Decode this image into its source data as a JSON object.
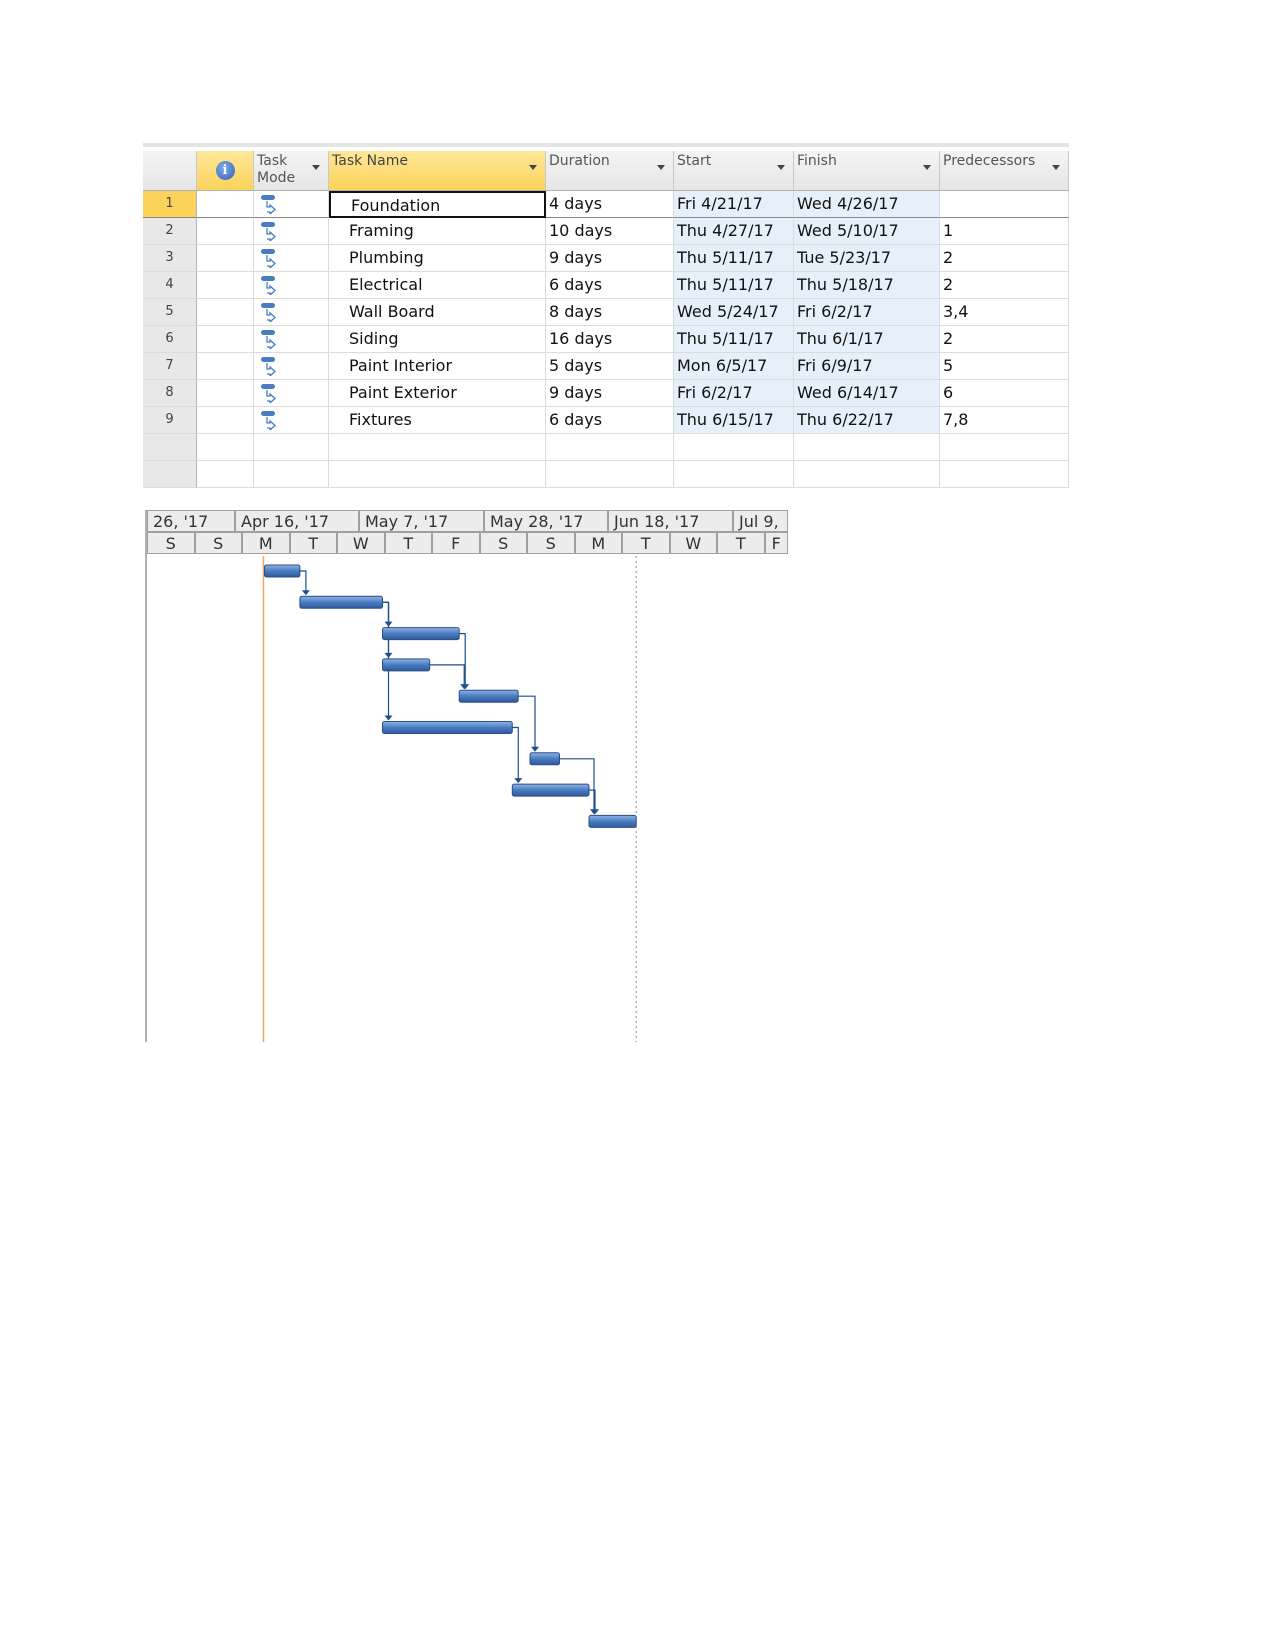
{
  "table": {
    "headers": {
      "info_icon": "info-icon",
      "task_mode": "Task Mode",
      "task_name": "Task Name",
      "duration": "Duration",
      "start": "Start",
      "finish": "Finish",
      "predecessors": "Predecessors"
    },
    "rows": [
      {
        "id": "1",
        "name": "Foundation",
        "duration": "4 days",
        "start": "Fri 4/21/17",
        "finish": "Wed 4/26/17",
        "pred": ""
      },
      {
        "id": "2",
        "name": "Framing",
        "duration": "10 days",
        "start": "Thu 4/27/17",
        "finish": "Wed 5/10/17",
        "pred": "1"
      },
      {
        "id": "3",
        "name": "Plumbing",
        "duration": "9 days",
        "start": "Thu 5/11/17",
        "finish": "Tue 5/23/17",
        "pred": "2"
      },
      {
        "id": "4",
        "name": "Electrical",
        "duration": "6 days",
        "start": "Thu 5/11/17",
        "finish": "Thu 5/18/17",
        "pred": "2"
      },
      {
        "id": "5",
        "name": "Wall Board",
        "duration": "8 days",
        "start": "Wed 5/24/17",
        "finish": "Fri 6/2/17",
        "pred": "3,4"
      },
      {
        "id": "6",
        "name": "Siding",
        "duration": "16 days",
        "start": "Thu 5/11/17",
        "finish": "Thu 6/1/17",
        "pred": "2"
      },
      {
        "id": "7",
        "name": "Paint Interior",
        "duration": "5 days",
        "start": "Mon 6/5/17",
        "finish": "Fri 6/9/17",
        "pred": "5"
      },
      {
        "id": "8",
        "name": "Paint Exterior",
        "duration": "9 days",
        "start": "Fri 6/2/17",
        "finish": "Wed 6/14/17",
        "pred": "6"
      },
      {
        "id": "9",
        "name": "Fixtures",
        "duration": "6 days",
        "start": "Thu 6/15/17",
        "finish": "Thu 6/22/17",
        "pred": "7,8"
      }
    ],
    "selected_row": "1"
  },
  "gantt": {
    "major_ticks": [
      "26, '17",
      "Apr 16, '17",
      "May 7, '17",
      "May 28, '17",
      "Jun 18, '17",
      "Jul 9,"
    ],
    "minor_ticks": [
      "S",
      "S",
      "M",
      "T",
      "W",
      "T",
      "F",
      "S",
      "S",
      "M",
      "T",
      "W",
      "T",
      "F"
    ],
    "bar_color": "#4a7cc0",
    "current_date_line_color": "#f4a460",
    "task_bars": [
      {
        "task": "Foundation",
        "start": "2017-04-21",
        "finish": "2017-04-26"
      },
      {
        "task": "Framing",
        "start": "2017-04-27",
        "finish": "2017-05-10"
      },
      {
        "task": "Plumbing",
        "start": "2017-05-11",
        "finish": "2017-05-23"
      },
      {
        "task": "Electrical",
        "start": "2017-05-11",
        "finish": "2017-05-18"
      },
      {
        "task": "Wall Board",
        "start": "2017-05-24",
        "finish": "2017-06-02"
      },
      {
        "task": "Siding",
        "start": "2017-05-11",
        "finish": "2017-06-01"
      },
      {
        "task": "Paint Interior",
        "start": "2017-06-05",
        "finish": "2017-06-09"
      },
      {
        "task": "Paint Exterior",
        "start": "2017-06-02",
        "finish": "2017-06-14"
      },
      {
        "task": "Fixtures",
        "start": "2017-06-15",
        "finish": "2017-06-22"
      }
    ]
  }
}
